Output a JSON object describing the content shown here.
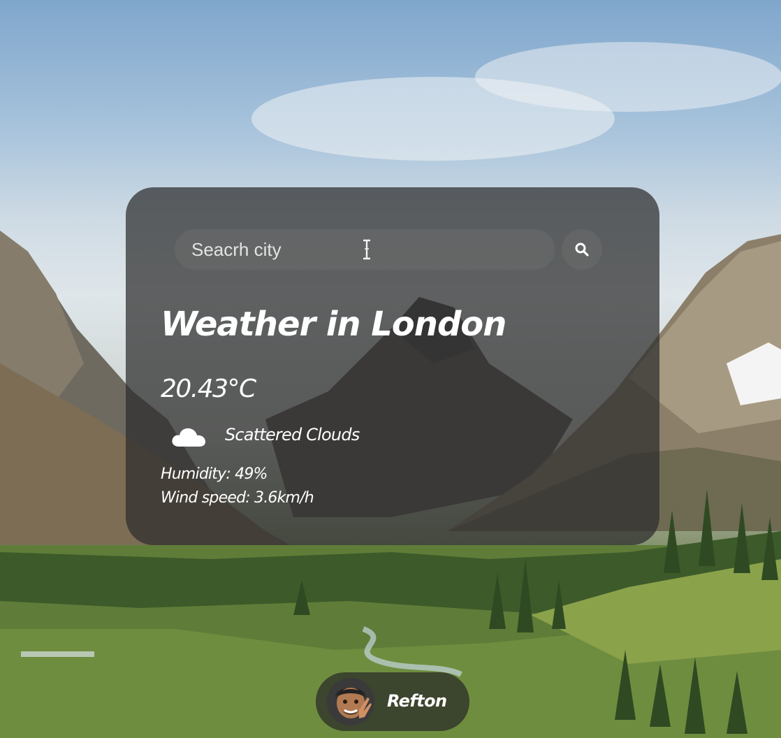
{
  "search": {
    "placeholder": "Seacrh city",
    "button_icon": "search-icon"
  },
  "weather": {
    "title": "Weather in London",
    "temperature": "20.43°C",
    "condition_icon": "cloud-icon",
    "condition": "Scattered Clouds",
    "humidity": "Humidity: 49%",
    "wind_speed": "Wind speed: 3.6km/h"
  },
  "profile": {
    "avatar_icon": "memoji-avatar",
    "name": "Refton"
  },
  "colors": {
    "card_background": "#2d2d2d",
    "text": "#ffffff",
    "input_background": "#6e6e6e"
  }
}
